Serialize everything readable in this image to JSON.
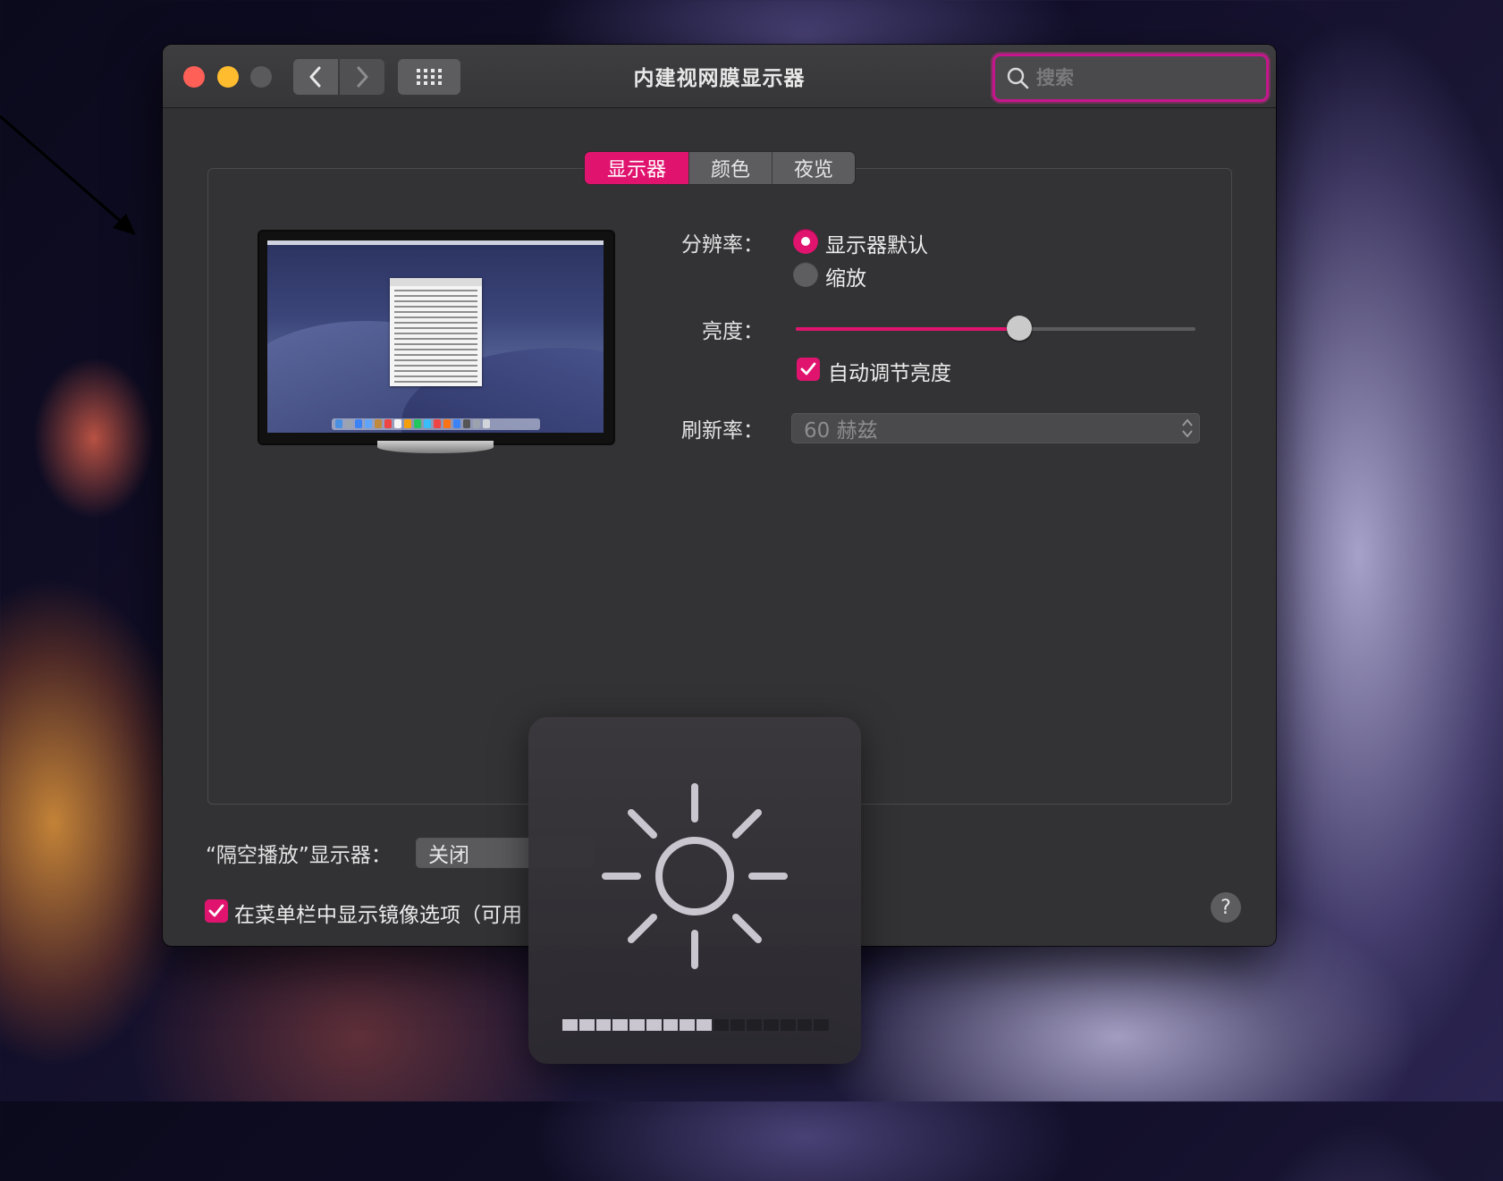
{
  "window": {
    "title": "内建视网膜显示器",
    "search_placeholder": "搜索"
  },
  "toolbar": {
    "back_icon": "chevron-left-icon",
    "forward_icon": "chevron-right-icon",
    "grid_icon": "show-all-grid-icon"
  },
  "tabs": [
    {
      "label": "显示器",
      "active": true
    },
    {
      "label": "颜色",
      "active": false
    },
    {
      "label": "夜览",
      "active": false
    }
  ],
  "display": {
    "resolution_label": "分辨率：",
    "resolution_options": [
      {
        "label": "显示器默认",
        "selected": true
      },
      {
        "label": "缩放",
        "selected": false
      }
    ],
    "brightness_label": "亮度：",
    "brightness_level": 0.56,
    "auto_brightness_label": "自动调节亮度",
    "auto_brightness_checked": true,
    "refresh_label": "刷新率：",
    "refresh_value": "60 赫兹"
  },
  "airplay": {
    "label": "“隔空播放”显示器：",
    "value": "关闭"
  },
  "mirror_option": {
    "label": "在菜单栏中显示镜像选项（可用",
    "checked": true
  },
  "help_label": "?",
  "hud": {
    "icon": "brightness-sun-icon",
    "segments_total": 16,
    "segments_on": 9
  },
  "colors": {
    "accent": "#e0146f",
    "window_bg": "#323234",
    "search_ring": "#c6168d"
  }
}
